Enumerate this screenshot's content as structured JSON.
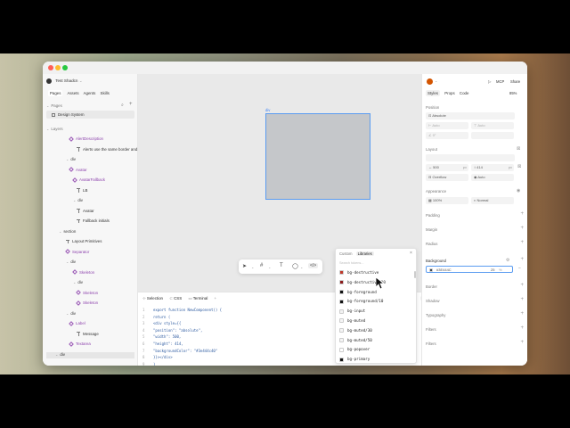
{
  "app": {
    "title": "Test Shadcn"
  },
  "left": {
    "tabs": [
      "Pages",
      "Assets",
      "Agents",
      "Skills"
    ],
    "pages_label": "Pages",
    "page_item": "Design System",
    "layers_label": "Layers",
    "layers": [
      {
        "label": "AlertDescription",
        "kind": "comp"
      },
      {
        "label": "Alerts use the same border and fo",
        "kind": "text"
      },
      {
        "label": "div",
        "kind": "box"
      },
      {
        "label": "Avatar",
        "kind": "comp"
      },
      {
        "label": "AvatarFallback",
        "kind": "comp"
      },
      {
        "label": "LB",
        "kind": "text"
      },
      {
        "label": "div",
        "kind": "box"
      },
      {
        "label": "Avatar",
        "kind": "text"
      },
      {
        "label": "Fallback initials",
        "kind": "text"
      },
      {
        "label": "section",
        "kind": "box"
      },
      {
        "label": "Layout Primitives",
        "kind": "text"
      },
      {
        "label": "Separator",
        "kind": "comp"
      },
      {
        "label": "div",
        "kind": "box"
      },
      {
        "label": "Skeleton",
        "kind": "comp"
      },
      {
        "label": "div",
        "kind": "box"
      },
      {
        "label": "Skeleton",
        "kind": "comp"
      },
      {
        "label": "Skeleton",
        "kind": "comp"
      },
      {
        "label": "div",
        "kind": "box"
      },
      {
        "label": "Label",
        "kind": "comp"
      },
      {
        "label": "Message",
        "kind": "text"
      },
      {
        "label": "Textarea",
        "kind": "comp"
      },
      {
        "label": "div",
        "kind": "box"
      }
    ]
  },
  "canvas": {
    "selection_label": "div",
    "box_color": "#C5C7CA"
  },
  "bottom": {
    "tabs": [
      "Selection",
      "CSS",
      "Terminal",
      "+"
    ],
    "apply_label": "Apply ⌘S",
    "copy_label": "Copy code ⌘⌥C",
    "code_lines": [
      "export function NewComponent() {",
      "  return (",
      "    <div style={{",
      "      \"position\": \"absolute\",",
      "      \"width\": 500,",
      "      \"height\": 414,",
      "      \"backgroundColor\": \"#3e444c40\"",
      "    }}></div>",
      "  )",
      "}"
    ]
  },
  "library": {
    "tabs": [
      "Custom",
      "Libraries"
    ],
    "search_placeholder": "Search tokens...",
    "items": [
      {
        "name": "bg-destructive",
        "color": "#c0392b"
      },
      {
        "name": "bg-destructive/10",
        "color": "#8b1a1a"
      },
      {
        "name": "bg-foreground",
        "color": "#111111"
      },
      {
        "name": "bg-foreground/10",
        "color": "#111111"
      },
      {
        "name": "bg-input",
        "color": "#f2f2f2"
      },
      {
        "name": "bg-muted",
        "color": "#f5f5f5"
      },
      {
        "name": "bg-muted/30",
        "color": "#f5f5f5"
      },
      {
        "name": "bg-muted/50",
        "color": "#f5f5f5"
      },
      {
        "name": "bg-popover",
        "color": "#ffffff"
      },
      {
        "name": "bg-primary",
        "color": "#111111"
      }
    ]
  },
  "right": {
    "mcp_label": "MCP",
    "share_label": "Share",
    "tabs": [
      "Styles",
      "Props",
      "Code"
    ],
    "zoom": "85%",
    "position_label": "Position",
    "position_value": "Absolute",
    "auto1": "Auto",
    "auto2": "Auto",
    "zero": "0°",
    "layout_label": "Layout",
    "width_value": "500",
    "height_value": "414",
    "unit_px": "px",
    "overflow_label": "Overflow",
    "auto3": "Auto",
    "appearance_label": "Appearance",
    "opacity_value": "100%",
    "blend_value": "Normal",
    "sections": [
      "Padding",
      "Margin",
      "Radius"
    ],
    "background_label": "Background",
    "bg_hex": "#3E444C",
    "bg_percent": "25",
    "bg_pct_sign": "%",
    "sections2": [
      "Border",
      "Shadow",
      "Typography",
      "Filters",
      "Filters"
    ]
  }
}
